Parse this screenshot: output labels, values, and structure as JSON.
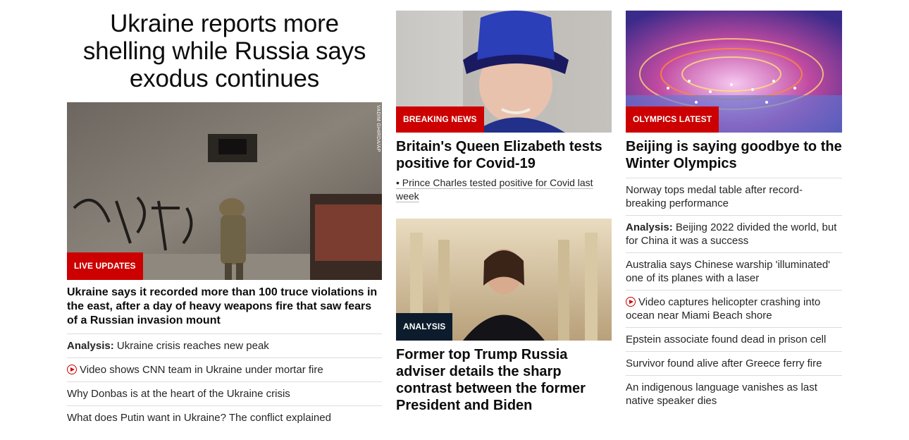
{
  "left": {
    "headline": "Ukraine reports more shelling while Russia says exodus continues",
    "image_alt": "Soldier walking past shell-damaged wall",
    "image_credit": "VADIM GHIRDA/AP",
    "badge": "LIVE UPDATES",
    "main_story": "Ukraine says it recorded more than 100 truce violations in the east, after a day of heavy weapons fire that saw fears of a Russian invasion mount",
    "links": [
      {
        "prefix": "Analysis:",
        "text": " Ukraine crisis reaches new peak",
        "video": false
      },
      {
        "prefix": "",
        "text": "Video shows CNN team in Ukraine under mortar fire",
        "video": true
      },
      {
        "prefix": "",
        "text": "Why Donbas is at the heart of the Ukraine crisis",
        "video": false
      },
      {
        "prefix": "",
        "text": "What does Putin want in Ukraine? The conflict explained",
        "video": false
      }
    ]
  },
  "middle": {
    "card1": {
      "badge": "BREAKING NEWS",
      "title": "Britain's Queen Elizabeth tests positive for Covid-19",
      "sub_link": "• Prince Charles tested positive for Covid last week"
    },
    "card2": {
      "badge": "ANALYSIS",
      "title": "Former top Trump Russia adviser details the sharp contrast between the former President and Biden"
    }
  },
  "right": {
    "badge": "OLYMPICS LATEST",
    "title": "Beijing is saying goodbye to the Winter Olympics",
    "links": [
      {
        "prefix": "",
        "text": "Norway tops medal table after record-breaking performance",
        "video": false
      },
      {
        "prefix": "Analysis:",
        "text": " Beijing 2022 divided the world, but for China it was a success",
        "video": false
      },
      {
        "prefix": "",
        "text": "Australia says Chinese warship 'illuminated' one of its planes with a laser",
        "video": false
      },
      {
        "prefix": "",
        "text": "Video captures helicopter crashing into ocean near Miami Beach shore",
        "video": true
      },
      {
        "prefix": "",
        "text": "Epstein associate found dead in prison cell",
        "video": false
      },
      {
        "prefix": "",
        "text": "Survivor found alive after Greece ferry fire",
        "video": false
      },
      {
        "prefix": "",
        "text": "An indigenous language vanishes as last native speaker dies",
        "video": false
      }
    ]
  },
  "colors": {
    "accent": "#cc0000",
    "dark_badge": "#0c1c2c",
    "divider": "#dcdcdc"
  }
}
